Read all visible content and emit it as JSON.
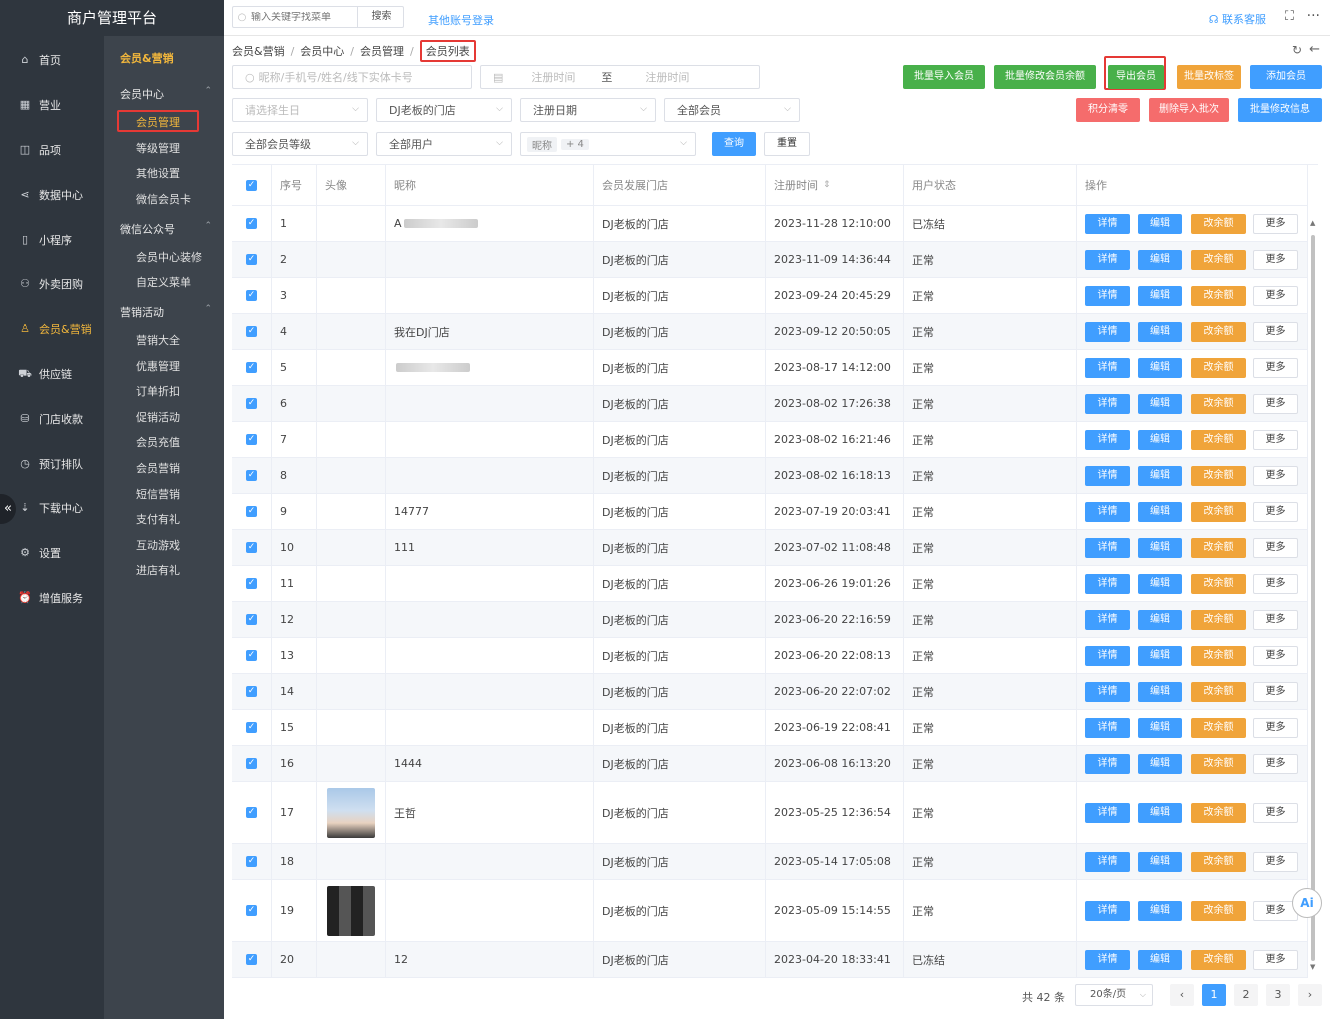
{
  "app": {
    "title": "商户管理平台"
  },
  "nav_primary": [
    {
      "label": "首页",
      "icon": "home-icon",
      "glyph": "⌂"
    },
    {
      "label": "营业",
      "icon": "calendar-icon",
      "glyph": "▦"
    },
    {
      "label": "品项",
      "icon": "bag-icon",
      "glyph": "◫"
    },
    {
      "label": "数据中心",
      "icon": "share-icon",
      "glyph": "⋖"
    },
    {
      "label": "小程序",
      "icon": "phone-icon",
      "glyph": "▯"
    },
    {
      "label": "外卖团购",
      "icon": "people-icon",
      "glyph": "⚇"
    },
    {
      "label": "会员&营销",
      "icon": "user-icon",
      "glyph": "♙"
    },
    {
      "label": "供应链",
      "icon": "truck-icon",
      "glyph": "⛟"
    },
    {
      "label": "门店收款",
      "icon": "coin-icon",
      "glyph": "⛁"
    },
    {
      "label": "预订排队",
      "icon": "clock-icon",
      "glyph": "◷"
    },
    {
      "label": "下载中心",
      "icon": "download-icon",
      "glyph": "⇣"
    },
    {
      "label": "设置",
      "icon": "gear-icon",
      "glyph": "⚙"
    },
    {
      "label": "增值服务",
      "icon": "alarm-icon",
      "glyph": "⏰"
    }
  ],
  "nav_secondary": {
    "header": "会员&营销",
    "groups": [
      {
        "label": "会员中心",
        "items": [
          "会员管理",
          "等级管理",
          "其他设置",
          "微信会员卡"
        ]
      },
      {
        "label": "微信公众号",
        "items": [
          "会员中心装修",
          "自定义菜单"
        ]
      },
      {
        "label": "营销活动",
        "items": [
          "营销大全",
          "优惠管理",
          "订单折扣",
          "促销活动",
          "会员充值",
          "会员营销",
          "短信营销",
          "支付有礼",
          "互动游戏",
          "进店有礼"
        ]
      }
    ]
  },
  "topbar": {
    "search_placeholder": "输入关键字找菜单",
    "search_button": "搜索",
    "other_login": "其他账号登录",
    "contact": "联系客服"
  },
  "breadcrumb": [
    "会员&营销",
    "会员中心",
    "会员管理",
    "会员列表"
  ],
  "filters": {
    "keyword_placeholder": "昵称/手机号/姓名/线下实体卡号",
    "date_start_placeholder": "注册时间",
    "date_sep": "至",
    "date_end_placeholder": "注册时间",
    "birthday_placeholder": "请选择生日",
    "store": "DJ老板的门店",
    "reg_date": "注册日期",
    "member_type": "全部会员",
    "member_level": "全部会员等级",
    "user_type": "全部用户",
    "tag": "昵称",
    "tag_more": "+ 4",
    "query_button": "查询",
    "reset_button": "重置"
  },
  "actions": {
    "batch_import": "批量导入会员",
    "batch_balance": "批量修改会员余额",
    "export": "导出会员",
    "batch_tag": "批量改标签",
    "add_member": "添加会员",
    "points_clear": "积分清零",
    "delete_import": "删除导入批次",
    "batch_modify_info": "批量修改信息"
  },
  "table": {
    "headers": {
      "index": "序号",
      "avatar": "头像",
      "nickname": "昵称",
      "store": "会员发展门店",
      "reg_time": "注册时间",
      "status": "用户状态",
      "ops": "操作"
    },
    "sort_icon": "⇕",
    "op_labels": {
      "detail": "详情",
      "edit": "编辑",
      "balance": "改余额",
      "more": "更多"
    },
    "rows": [
      {
        "idx": "1",
        "nickname": "A",
        "nick_blurred": true,
        "store": "DJ老板的门店",
        "time": "2023-11-28 12:10:00",
        "status": "已冻结"
      },
      {
        "idx": "2",
        "nickname": "",
        "store": "DJ老板的门店",
        "time": "2023-11-09 14:36:44",
        "status": "正常"
      },
      {
        "idx": "3",
        "nickname": "",
        "store": "DJ老板的门店",
        "time": "2023-09-24 20:45:29",
        "status": "正常"
      },
      {
        "idx": "4",
        "nickname": "我在DJ门店",
        "store": "DJ老板的门店",
        "time": "2023-09-12 20:50:05",
        "status": "正常"
      },
      {
        "idx": "5",
        "nickname": "",
        "nick_blurred": true,
        "store": "DJ老板的门店",
        "time": "2023-08-17 14:12:00",
        "status": "正常"
      },
      {
        "idx": "6",
        "nickname": "",
        "store": "DJ老板的门店",
        "time": "2023-08-02 17:26:38",
        "status": "正常"
      },
      {
        "idx": "7",
        "nickname": "",
        "store": "DJ老板的门店",
        "time": "2023-08-02 16:21:46",
        "status": "正常"
      },
      {
        "idx": "8",
        "nickname": "",
        "store": "DJ老板的门店",
        "time": "2023-08-02 16:18:13",
        "status": "正常"
      },
      {
        "idx": "9",
        "nickname": "14777",
        "store": "DJ老板的门店",
        "time": "2023-07-19 20:03:41",
        "status": "正常"
      },
      {
        "idx": "10",
        "nickname": "111",
        "store": "DJ老板的门店",
        "time": "2023-07-02 11:08:48",
        "status": "正常"
      },
      {
        "idx": "11",
        "nickname": "",
        "store": "DJ老板的门店",
        "time": "2023-06-26 19:01:26",
        "status": "正常"
      },
      {
        "idx": "12",
        "nickname": "",
        "store": "DJ老板的门店",
        "time": "2023-06-20 22:16:59",
        "status": "正常"
      },
      {
        "idx": "13",
        "nickname": "",
        "store": "DJ老板的门店",
        "time": "2023-06-20 22:08:13",
        "status": "正常"
      },
      {
        "idx": "14",
        "nickname": "",
        "store": "DJ老板的门店",
        "time": "2023-06-20 22:07:02",
        "status": "正常"
      },
      {
        "idx": "15",
        "nickname": "",
        "store": "DJ老板的门店",
        "time": "2023-06-19 22:08:41",
        "status": "正常"
      },
      {
        "idx": "16",
        "nickname": "1444",
        "store": "DJ老板的门店",
        "time": "2023-06-08 16:13:20",
        "status": "正常"
      },
      {
        "idx": "17",
        "nickname": "王哲",
        "avatar": "photo",
        "store": "DJ老板的门店",
        "time": "2023-05-25 12:36:54",
        "status": "正常"
      },
      {
        "idx": "18",
        "nickname": "",
        "store": "DJ老板的门店",
        "time": "2023-05-14 17:05:08",
        "status": "正常"
      },
      {
        "idx": "19",
        "nickname": "",
        "avatar": "blurred",
        "store": "DJ老板的门店",
        "time": "2023-05-09 15:14:55",
        "status": "正常"
      },
      {
        "idx": "20",
        "nickname": "12",
        "store": "DJ老板的门店",
        "time": "2023-04-20 18:33:41",
        "status": "已冻结"
      }
    ]
  },
  "pagination": {
    "total": "共 42 条",
    "page_size": "20条/页",
    "pages": [
      "1",
      "2",
      "3"
    ],
    "current": "1",
    "prev": "‹",
    "next": "›"
  },
  "ai_label": "Ai",
  "colors": {
    "primary": "#409eff",
    "green": "#48b04a",
    "orange": "#f0a43a",
    "red": "#f56c6c",
    "highlight": "#e53935",
    "sidebar": "#2f363e"
  }
}
